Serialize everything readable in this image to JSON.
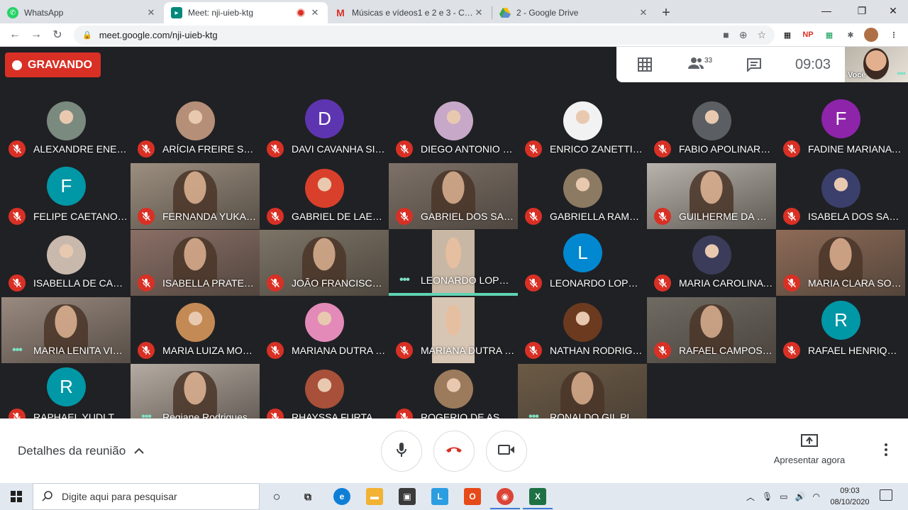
{
  "browser": {
    "tabs": [
      {
        "title": "WhatsApp",
        "active": false,
        "icon": "whatsapp-icon"
      },
      {
        "title": "Meet: nji-uieb-ktg",
        "active": true,
        "icon": "meet-icon"
      },
      {
        "title": "Músicas e vídeos1 e 2 e 3 - Conv",
        "active": false,
        "icon": "gmail-icon"
      },
      {
        "title": "2 - Google Drive",
        "active": false,
        "icon": "drive-icon"
      }
    ],
    "url": "meet.google.com/nji-uieb-ktg"
  },
  "meet": {
    "recording_label": "GRAVANDO",
    "participant_count": "33",
    "clock": "09:03",
    "self_label": "Você",
    "tiles": [
      {
        "name": "ALEXANDRE ENEA…",
        "muted": true,
        "kind": "photo",
        "color": "#7a8a7f"
      },
      {
        "name": "ARÍCIA FREIRE SAN…",
        "muted": true,
        "kind": "photo",
        "color": "#b68f78"
      },
      {
        "name": "DAVI CAVANHA SIL…",
        "muted": true,
        "kind": "letter",
        "letter": "D",
        "color": "#5e35b1"
      },
      {
        "name": "DIEGO ANTONIO SI…",
        "muted": true,
        "kind": "photo",
        "color": "#c7a8c9"
      },
      {
        "name": "ENRICO ZANETTI A…",
        "muted": true,
        "kind": "photo",
        "color": "#f2f2f2"
      },
      {
        "name": "FABIO APOLINARIO…",
        "muted": true,
        "kind": "photo",
        "color": "#5b5e62"
      },
      {
        "name": "FADINE MARIANA L…",
        "muted": true,
        "kind": "letter",
        "letter": "F",
        "color": "#8e24aa"
      },
      {
        "name": "FELIPE CAETANO …",
        "muted": true,
        "kind": "letter",
        "letter": "F",
        "color": "#0097a7"
      },
      {
        "name": "FERNANDA YUKARI…",
        "muted": true,
        "kind": "video",
        "color": "#9c8f80"
      },
      {
        "name": "GABRIEL DE LAET …",
        "muted": true,
        "kind": "photo",
        "color": "#d9402b"
      },
      {
        "name": "GABRIEL DOS SAN…",
        "muted": true,
        "kind": "video",
        "color": "#7d7168"
      },
      {
        "name": "GABRIELLA RAMOS…",
        "muted": true,
        "kind": "photo",
        "color": "#8d7a62"
      },
      {
        "name": "GUILHERME DA CO…",
        "muted": true,
        "kind": "video",
        "color": "#b9b3ad"
      },
      {
        "name": "ISABELA DOS SANT…",
        "muted": true,
        "kind": "photo",
        "color": "#3a3f6b"
      },
      {
        "name": "ISABELLA DE CAM…",
        "muted": true,
        "kind": "photo",
        "color": "#c9b9ad"
      },
      {
        "name": "ISABELLA PRATES …",
        "muted": true,
        "kind": "video",
        "color": "#8a6f66"
      },
      {
        "name": "JOÃO FRANCISCO …",
        "muted": true,
        "kind": "video",
        "color": "#7c7466"
      },
      {
        "name": "LEONARDO LOPES …",
        "muted": false,
        "kind": "portrait",
        "color": "#c8b7a4",
        "active": true
      },
      {
        "name": "LEONARDO LOPES …",
        "muted": true,
        "kind": "letter",
        "letter": "L",
        "color": "#0288d1"
      },
      {
        "name": "MARIA CAROLINA …",
        "muted": true,
        "kind": "photo",
        "color": "#3b3b5a"
      },
      {
        "name": "MARIA CLARA SOA…",
        "muted": true,
        "kind": "video",
        "color": "#8e6b57"
      },
      {
        "name": "MARIA LENITA VIV…",
        "muted": false,
        "kind": "video",
        "color": "#9a8a80"
      },
      {
        "name": "MARIA LUIZA MOR…",
        "muted": true,
        "kind": "photo",
        "color": "#c48a55"
      },
      {
        "name": "MARIANA DUTRA D…",
        "muted": true,
        "kind": "photo",
        "color": "#e38ab8"
      },
      {
        "name": "MARIANA DUTRA D…",
        "muted": true,
        "kind": "portrait",
        "color": "#d8c6b5"
      },
      {
        "name": "NATHAN RODRIGU…",
        "muted": true,
        "kind": "photo",
        "color": "#6b3a1f"
      },
      {
        "name": "RAFAEL CAMPOS B…",
        "muted": true,
        "kind": "video",
        "color": "#6f6a62"
      },
      {
        "name": "RAFAEL HENRIQUE …",
        "muted": true,
        "kind": "letter",
        "letter": "R",
        "color": "#0097a7"
      },
      {
        "name": "RAPHAEL YUDI TAK…",
        "muted": true,
        "kind": "letter",
        "letter": "R",
        "color": "#0097a7"
      },
      {
        "name": "Regiane Rodrigues",
        "muted": false,
        "kind": "video",
        "color": "#b5aba2"
      },
      {
        "name": "RHAYSSA FURTAD…",
        "muted": true,
        "kind": "photo",
        "color": "#a8503a"
      },
      {
        "name": "ROGERIO DE ASSIS …",
        "muted": true,
        "kind": "photo",
        "color": "#9c7b5c"
      },
      {
        "name": "RONALDO GIL PISA…",
        "muted": false,
        "kind": "video",
        "color": "#6c5a45"
      }
    ],
    "meeting_details": "Detalhes da reunião",
    "present_now": "Apresentar agora"
  },
  "taskbar": {
    "search_placeholder": "Digite aqui para pesquisar",
    "time": "09:03",
    "date": "08/10/2020"
  }
}
